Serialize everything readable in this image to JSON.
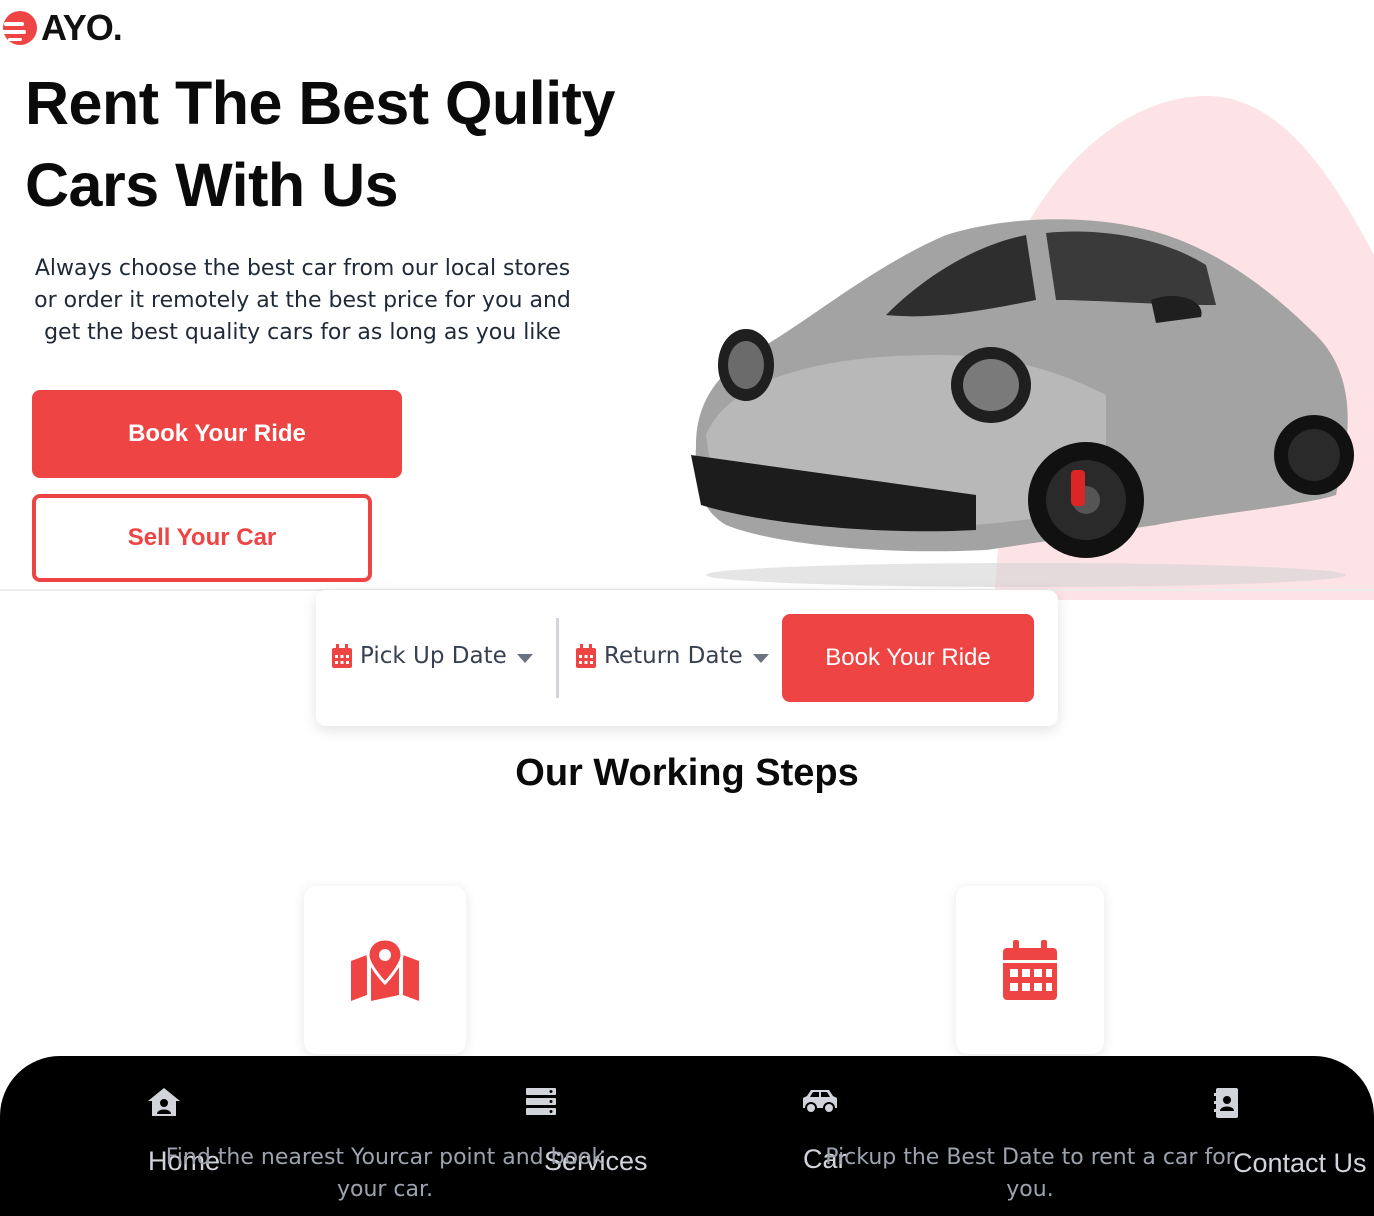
{
  "brand": {
    "logo_text": "AYO."
  },
  "hero": {
    "title": "Rent The Best Qulity Cars With Us",
    "description": "Always choose the best car from our local stores or order it remotely at the best price for you and get the best quality cars for as long as you like",
    "primary_button": "Book Your Ride",
    "secondary_button": "Sell Your Car"
  },
  "booking": {
    "pickup_label": "Pick Up Date",
    "return_label": "Return Date",
    "book_button": "Book Your Ride"
  },
  "steps": {
    "title": "Our Working Steps",
    "items": [
      {
        "icon": "map-location-icon",
        "description": "Find the nearest Yourcar point and book your car."
      },
      {
        "icon": "calendar-icon",
        "description": "Pickup the Best Date to rent a car for you."
      }
    ]
  },
  "bottom_nav": {
    "items": [
      {
        "label": "Home",
        "icon": "house-user-icon"
      },
      {
        "label": "Services",
        "icon": "server-icon"
      },
      {
        "label": "Car",
        "icon": "car-icon"
      },
      {
        "label": "Contact Us",
        "icon": "address-book-icon"
      }
    ]
  },
  "colors": {
    "accent": "#ef4444",
    "blob": "#fde2e6",
    "nav_bg": "#000000"
  }
}
